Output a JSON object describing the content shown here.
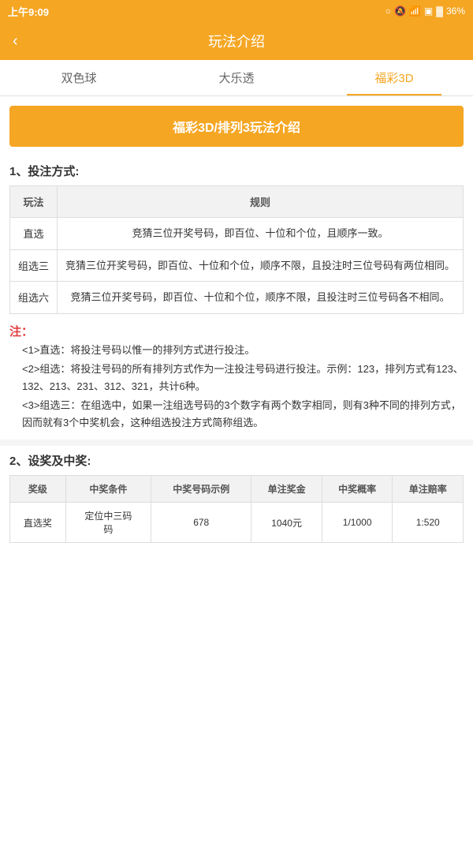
{
  "statusBar": {
    "time": "上午9:09",
    "battery": "36%"
  },
  "header": {
    "back": "‹",
    "title": "玩法介绍"
  },
  "tabs": [
    {
      "id": "tab1",
      "label": "双色球",
      "active": false
    },
    {
      "id": "tab2",
      "label": "大乐透",
      "active": false
    },
    {
      "id": "tab3",
      "label": "福彩3D",
      "active": true
    }
  ],
  "banner": {
    "text": "福彩3D/排列3玩法介绍"
  },
  "section1": {
    "title": "1、投注方式:",
    "tableHeader": [
      "玩法",
      "规则"
    ],
    "rows": [
      {
        "name": "直选",
        "rule": "竞猜三位开奖号码，即百位、十位和个位，且顺序一致。"
      },
      {
        "name": "组选三",
        "rule": "竞猜三位开奖号码，即百位、十位和个位，顺序不限，且投注时三位号码有两位相同。"
      },
      {
        "name": "组选六",
        "rule": "竞猜三位开奖号码，即百位、十位和个位，顺序不限，且投注时三位号码各不相同。"
      }
    ]
  },
  "notes": {
    "label": "注：",
    "items": [
      "<1>直选：将投注号码以惟一的排列方式进行投注。",
      "<2>组选：将投注号码的所有排列方式作为一注投注号码进行投注。示例：123，排列方式有123、132、213、231、312、321，共计6种。",
      "<3>组选三：在组选中，如果一注组选号码的3个数字有两个数字相同，则有3种不同的排列方式，因而就有3个中奖机会，这种组选投注方式简称组选。"
    ]
  },
  "section2": {
    "title": "2、设奖及中奖:",
    "tableHeaders": [
      "奖级",
      "中奖条件",
      "中奖号码示例",
      "单注奖金",
      "中奖概率",
      "单注赔率"
    ],
    "rows": [
      {
        "level": "直选奖",
        "condition": "定位中三码",
        "example": "678",
        "prize": "1040元",
        "probability": "1/1000",
        "odds": "1:520"
      }
    ]
  }
}
